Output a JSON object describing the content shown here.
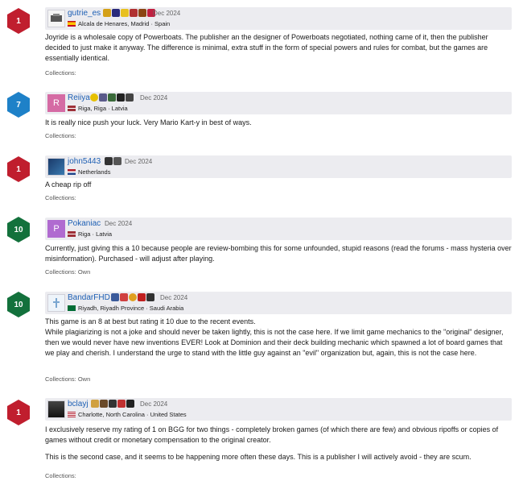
{
  "reviews": [
    {
      "rating": "1",
      "username": "gutrie_es",
      "date": "Dec 2024",
      "location": "Alcala de Henares, Madrid · Spain",
      "text": [
        "Joyride is a wholesale copy of Powerboats. The publisher an the designer of Powerboats negotiated, nothing came of it, then the publisher decided to just make it anyway. The difference is minimal, extra stuff in the form of special powers and rules for combat, but the games are essentially identical."
      ],
      "collections": "Collections:"
    },
    {
      "rating": "7",
      "username": "Reiiya",
      "avatar_letter": "R",
      "date": "Dec 2024",
      "location": "Riga, Riga · Latvia",
      "text": [
        "It is really nice push your luck. Very Mario Kart-y in best of ways."
      ],
      "collections": "Collections:"
    },
    {
      "rating": "1",
      "username": "john5443",
      "date": "Dec 2024",
      "location": "Netherlands",
      "text": [
        "A cheap rip off"
      ],
      "collections": "Collections:"
    },
    {
      "rating": "10",
      "username": "Pokaniac",
      "avatar_letter": "P",
      "date": "Dec 2024",
      "location": "Riga · Latvia",
      "text": [
        "Currently, just giving this a 10 because people are review-bombing this for some unfounded, stupid reasons (read the forums - mass hysteria over misinformation). Purchased - will adjust after playing."
      ],
      "collections": "Collections: Own"
    },
    {
      "rating": "10",
      "username": "BandarFHD",
      "date": "Dec 2024",
      "location": "Riyadh, Riyadh Province · Saudi Arabia",
      "text": [
        "This game is an 8 at best but rating it 10 due to the recent events.",
        "While plagiarizing is not a joke and should never be taken lightly, this is not the case here. If we limit game mechanics to the \"original\" designer, then we would never have new inventions EVER! Look at Dominion and their deck building mechanic which spawned a lot of board games that we play and cherish. I understand the urge to stand with the little guy against an \"evil\" organization but, again, this is not the case here."
      ],
      "collections": "Collections: Own"
    },
    {
      "rating": "1",
      "username": "bclayj",
      "date": "Dec 2024",
      "location": "Charlotte, North Carolina · United States",
      "text": [
        "I exclusively reserve my rating of 1 on BGG for two things - completely broken games (of which there are few) and obvious ripoffs or copies of games without credit or monetary compensation to the original creator.",
        "This is the second case, and it seems to be happening more often these days. This is a publisher I will actively avoid - they are scum."
      ],
      "collections": "Collections:"
    }
  ],
  "colors": {
    "rating_low": "#c01e2e",
    "rating_mid": "#1e81c8",
    "rating_high": "#13713c",
    "username": "#1d5fb4",
    "header_bg": "#ececf0"
  }
}
